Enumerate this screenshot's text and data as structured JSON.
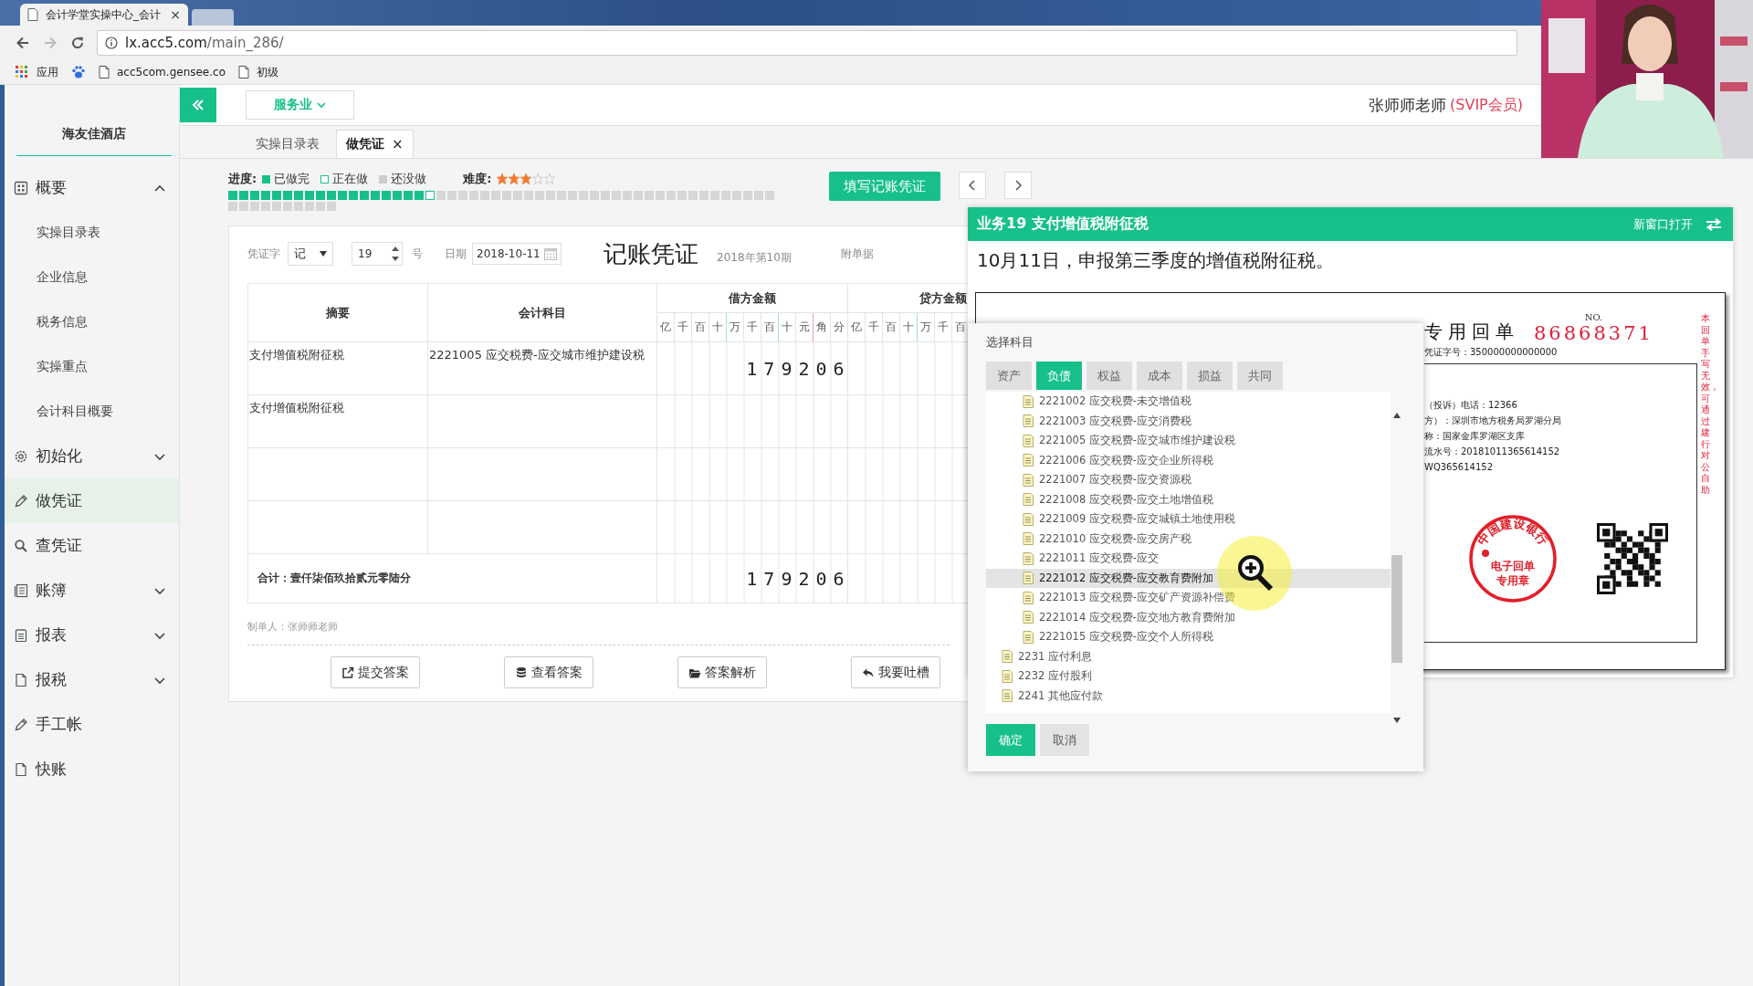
{
  "browser": {
    "tab_title": "会计学堂实操中心_会计",
    "close": "×",
    "url_host": "lx.acc5.com",
    "url_path": "/main_286/",
    "bookmarks": [
      {
        "kind": "apps",
        "label": "应用"
      },
      {
        "kind": "paw"
      },
      {
        "kind": "page",
        "label": "acc5com.gensee.co"
      },
      {
        "kind": "page",
        "label": "初级"
      }
    ]
  },
  "sidebar": {
    "company": "海友佳酒店",
    "items": [
      {
        "kind": "group",
        "label": "概要",
        "expanded": true,
        "selected": false,
        "children": [
          {
            "label": "实操目录表",
            "selected": false
          },
          {
            "label": "企业信息",
            "selected": false
          },
          {
            "label": "税务信息",
            "selected": false
          },
          {
            "label": "实操重点",
            "selected": false
          },
          {
            "label": "会计科目概要",
            "selected": false
          }
        ]
      },
      {
        "kind": "group",
        "label": "初始化",
        "expanded": false,
        "selected": false
      },
      {
        "kind": "link",
        "label": "做凭证",
        "selected": true
      },
      {
        "kind": "link",
        "label": "查凭证",
        "selected": false
      },
      {
        "kind": "group",
        "label": "账簿",
        "expanded": false,
        "selected": false
      },
      {
        "kind": "group",
        "label": "报表",
        "expanded": false,
        "selected": false
      },
      {
        "kind": "group",
        "label": "报税",
        "expanded": false,
        "selected": false
      },
      {
        "kind": "link",
        "label": "手工帐",
        "selected": false
      },
      {
        "kind": "link",
        "label": "快账",
        "selected": false
      }
    ]
  },
  "topbar": {
    "industry": "服务业",
    "user": "张师师老师",
    "membership": "(SVIP会员)"
  },
  "tabs": [
    {
      "label": "实操目录表",
      "selected": false
    },
    {
      "label": "做凭证",
      "selected": true,
      "close": "×"
    }
  ],
  "progress": {
    "label": "进度:",
    "legend": [
      {
        "kind": "done",
        "label": "已做完"
      },
      {
        "kind": "current",
        "label": "正在做"
      },
      {
        "kind": "todo",
        "label": "还没做"
      }
    ],
    "difficulty_label": "难度:",
    "stars": 3,
    "steps": [
      {
        "kind": "done"
      },
      {
        "kind": "done"
      },
      {
        "kind": "done"
      },
      {
        "kind": "done"
      },
      {
        "kind": "done"
      },
      {
        "kind": "done"
      },
      {
        "kind": "done"
      },
      {
        "kind": "done"
      },
      {
        "kind": "done"
      },
      {
        "kind": "done"
      },
      {
        "kind": "done"
      },
      {
        "kind": "done"
      },
      {
        "kind": "done"
      },
      {
        "kind": "done"
      },
      {
        "kind": "done"
      },
      {
        "kind": "done"
      },
      {
        "kind": "done"
      },
      {
        "kind": "done"
      },
      {
        "kind": "current"
      },
      {
        "kind": "todo"
      },
      {
        "kind": "todo"
      },
      {
        "kind": "todo"
      },
      {
        "kind": "todo"
      },
      {
        "kind": "todo"
      },
      {
        "kind": "todo"
      },
      {
        "kind": "todo"
      },
      {
        "kind": "todo"
      },
      {
        "kind": "todo"
      },
      {
        "kind": "todo"
      },
      {
        "kind": "todo"
      },
      {
        "kind": "todo"
      },
      {
        "kind": "todo"
      },
      {
        "kind": "todo"
      },
      {
        "kind": "todo"
      },
      {
        "kind": "todo"
      },
      {
        "kind": "todo"
      },
      {
        "kind": "todo"
      },
      {
        "kind": "todo"
      },
      {
        "kind": "todo"
      },
      {
        "kind": "todo"
      },
      {
        "kind": "todo"
      },
      {
        "kind": "todo"
      },
      {
        "kind": "todo"
      },
      {
        "kind": "todo"
      },
      {
        "kind": "todo"
      },
      {
        "kind": "todo"
      },
      {
        "kind": "todo"
      },
      {
        "kind": "todo"
      },
      {
        "kind": "todo"
      },
      {
        "kind": "todo"
      },
      {
        "kind": "todo"
      },
      {
        "kind": "todo"
      },
      {
        "kind": "todo"
      },
      {
        "kind": "todo"
      },
      {
        "kind": "todo"
      },
      {
        "kind": "todo"
      },
      {
        "kind": "todo"
      },
      {
        "kind": "todo"
      },
      {
        "kind": "todo"
      },
      {
        "kind": "todo"
      }
    ]
  },
  "fill_button": "填写记账凭证",
  "voucher": {
    "word_label": "凭证字",
    "word": "记",
    "number": "19",
    "number_suffix": "号",
    "date_label": "日期",
    "date": "2018-10-11",
    "title": "记账凭证",
    "period": "2018年第10期",
    "attachments_label": "附单据",
    "columns": {
      "summary": "摘要",
      "account": "会计科目",
      "debit": "借方金额",
      "credit": "贷方金额"
    },
    "debit_digits": [
      "亿",
      "千",
      "百",
      "十",
      "万",
      "千",
      "百",
      "十",
      "元",
      "角",
      "分"
    ],
    "credit_digits": [
      "亿",
      "千",
      "百",
      "十",
      "万",
      "千",
      "百"
    ],
    "rows": [
      {
        "summary": "支付增值税附征税",
        "account": "2221005 应交税费-应交城市维护建设税",
        "debit": "179206"
      },
      {
        "summary": "支付增值税附征税"
      }
    ],
    "total_label": "合计：壹仟柒佰玖拾贰元零陆分",
    "total_debit": "179206",
    "maker": "制单人：张师师老师",
    "actions": [
      {
        "label": "提交答案"
      },
      {
        "label": "查看答案"
      },
      {
        "label": "答案解析"
      },
      {
        "label": "我要吐槽"
      }
    ]
  },
  "task": {
    "title": "业务19 支付增值税附征税",
    "open_new": "新窗口打开",
    "description": "10月11日，申报第三季度的增值税附征税。",
    "receipt": {
      "heading": "专用回单",
      "no_label": "NO.",
      "number": "86868371",
      "voucher_no": "凭证字号：350000000000000",
      "lines": [
        "（投诉）电话：12366",
        "方）：深圳市地方税务局罗湖分局",
        "称：国家金库罗湖区支库",
        "流水号：20181011365614152",
        "WQ365614152"
      ],
      "side_note": "本回单手写无效，可通过建行对公自助",
      "stamp": {
        "arc": "中国建设银行",
        "lines": [
          "电子回单",
          "专用章"
        ]
      }
    }
  },
  "dialog": {
    "title": "选择科目",
    "tabs": [
      {
        "label": "资产",
        "selected": false
      },
      {
        "label": "负债",
        "selected": true
      },
      {
        "label": "权益",
        "selected": false
      },
      {
        "label": "成本",
        "selected": false
      },
      {
        "label": "损益",
        "selected": false
      },
      {
        "label": "共同",
        "selected": false
      }
    ],
    "subjects": [
      {
        "children": [
          {
            "label": "2221002 应交税费-未交增值税",
            "selected": false
          },
          {
            "label": "2221003 应交税费-应交消费税",
            "selected": false
          },
          {
            "label": "2221005 应交税费-应交城市维护建设税",
            "selected": false
          },
          {
            "label": "2221006 应交税费-应交企业所得税",
            "selected": false
          },
          {
            "label": "2221007 应交税费-应交资源税",
            "selected": false
          },
          {
            "label": "2221008 应交税费-应交土地增值税",
            "selected": false
          },
          {
            "label": "2221009 应交税费-应交城镇土地使用税",
            "selected": false
          },
          {
            "label": "2221010 应交税费-应交房产税",
            "selected": false
          },
          {
            "label": "2221011 应交税费-应交",
            "selected": false
          },
          {
            "label": "2221012 应交税费-应交教育费附加",
            "selected": true
          },
          {
            "label": "2221013 应交税费-应交矿产资源补偿费",
            "selected": false
          },
          {
            "label": "2221014 应交税费-应交地方教育费附加",
            "selected": false
          },
          {
            "label": "2221015 应交税费-应交个人所得税",
            "selected": false
          }
        ]
      },
      {
        "label": "2231 应付利息",
        "selected": false
      },
      {
        "label": "2232 应付股利",
        "selected": false
      },
      {
        "label": "2241 其他应付款",
        "selected": false
      }
    ],
    "buttons": [
      {
        "kind": "primary",
        "label": "确定"
      },
      {
        "kind": "secondary",
        "label": "取消"
      }
    ]
  }
}
